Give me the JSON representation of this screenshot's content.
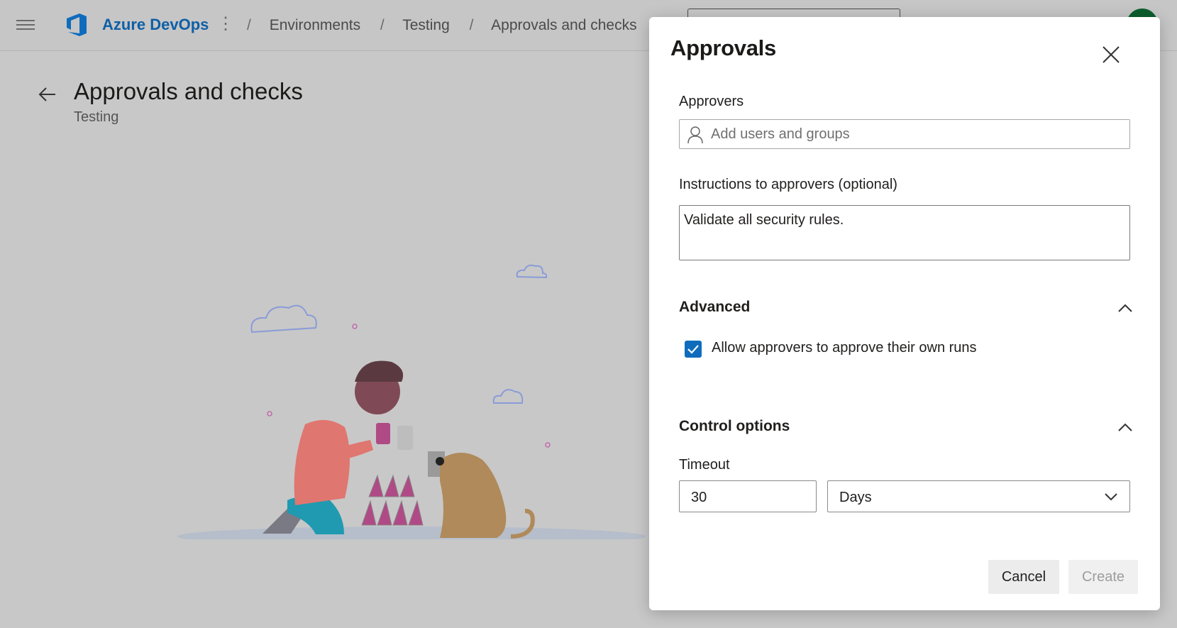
{
  "header": {
    "brand": "Azure DevOps",
    "breadcrumbs": [
      "Environments",
      "Testing",
      "Approvals and checks"
    ],
    "separator": "/"
  },
  "page": {
    "title": "Approvals and checks",
    "subtitle": "Testing"
  },
  "panel": {
    "title": "Approvals",
    "approvers_label": "Approvers",
    "approvers_placeholder": "Add users and groups",
    "instructions_label": "Instructions to approvers (optional)",
    "instructions_value": "Validate all security rules.",
    "advanced_header": "Advanced",
    "allow_self_approve_label": "Allow approvers to approve their own runs",
    "allow_self_approve_checked": true,
    "control_header": "Control options",
    "timeout_label": "Timeout",
    "timeout_value": "30",
    "timeout_unit": "Days",
    "cancel_label": "Cancel",
    "create_label": "Create"
  },
  "colors": {
    "brand": "#0f5fa6",
    "accent": "#0f6cbd",
    "avatar": "#0b5e2e"
  }
}
